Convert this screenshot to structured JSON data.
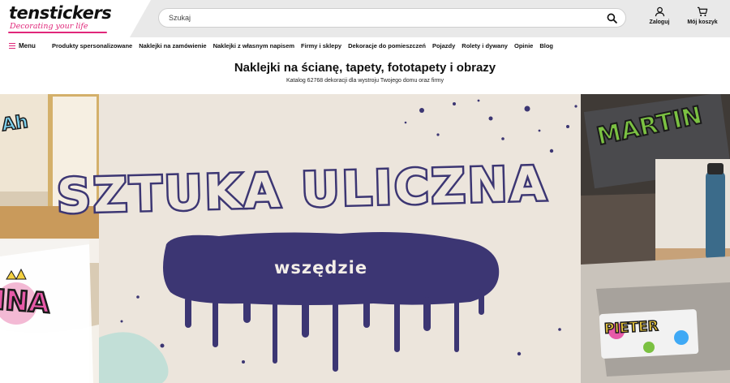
{
  "brand": {
    "name": "tenstickers",
    "tagline": "Decorating your life",
    "accent_color": "#e0277a"
  },
  "search": {
    "placeholder": "Szukaj",
    "icon": "search-icon"
  },
  "header_actions": {
    "login_label": "Zaloguj",
    "cart_label": "Mój koszyk"
  },
  "nav": {
    "menu_label": "Menu",
    "items": [
      {
        "label": "Produkty spersonalizowane"
      },
      {
        "label": "Naklejki na zamówienie"
      },
      {
        "label": "Naklejki z własnym napisem"
      },
      {
        "label": "Firmy i sklepy"
      },
      {
        "label": "Dekoracje do pomieszczeń"
      },
      {
        "label": "Pojazdy"
      },
      {
        "label": "Rolety i dywany"
      },
      {
        "label": "Opinie"
      },
      {
        "label": "Blog"
      }
    ]
  },
  "page": {
    "title": "Naklejki na ścianę, tapety, fototapety i obrazy",
    "subtitle": "Katalog 62768 dekoracji dla wystroju Twojego domu oraz firmy"
  },
  "banner": {
    "headline": "SZTUKA ULICZNA",
    "tagline": "wszędzie",
    "sticker_martin": "MARTIN",
    "sticker_pieter": "PIETER",
    "sticker_ina": "INA",
    "sticker_ah": "Ah",
    "paint_color": "#3c3673",
    "background_color": "#ede6dd"
  }
}
